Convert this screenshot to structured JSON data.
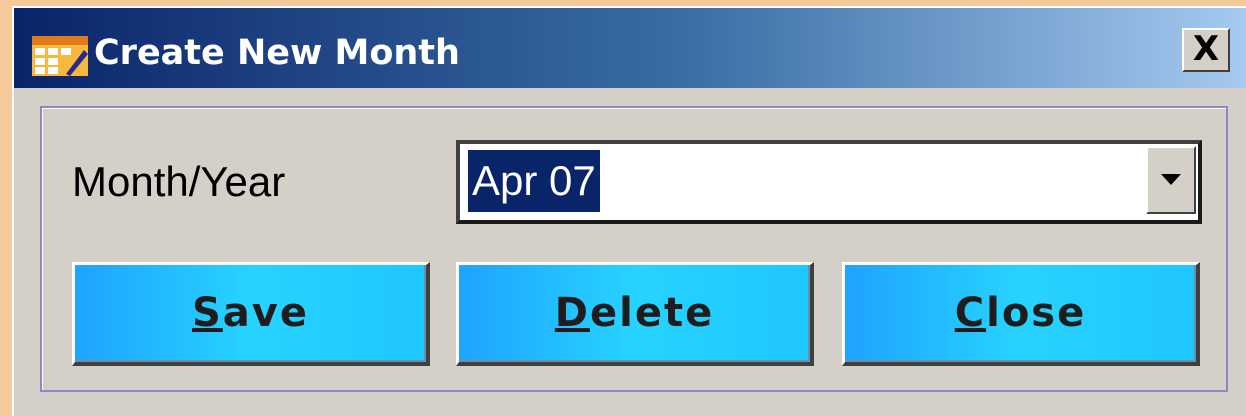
{
  "window": {
    "title": "Create New Month",
    "close_label": "X"
  },
  "form": {
    "month_year_label": "Month/Year",
    "month_year_value": "Apr 07"
  },
  "buttons": {
    "save": {
      "mnemonic": "S",
      "rest": "ave"
    },
    "delete": {
      "mnemonic": "D",
      "rest": "elete"
    },
    "close": {
      "mnemonic": "C",
      "rest": "lose"
    }
  },
  "icons": {
    "title_icon": "calendar-icon",
    "dropdown_icon": "chevron-down-icon"
  },
  "colors": {
    "title_bar": "#0a246a",
    "button_accent": "#27d3ff",
    "selection": "#0a246a"
  }
}
